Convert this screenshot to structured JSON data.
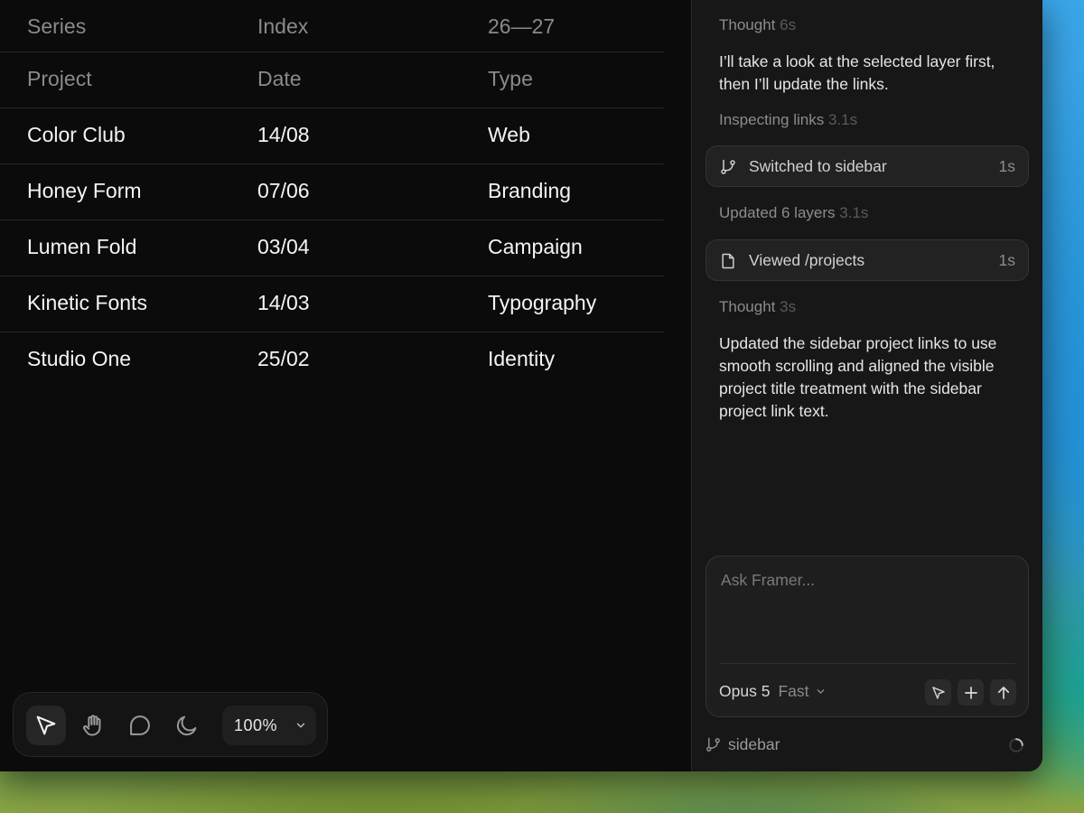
{
  "table": {
    "header_rows": [
      [
        "Series",
        "Index",
        "26—27"
      ],
      [
        "Project",
        "Date",
        "Type"
      ]
    ],
    "rows": [
      [
        "Color Club",
        "14/08",
        "Web"
      ],
      [
        "Honey Form",
        "07/06",
        "Branding"
      ],
      [
        "Lumen Fold",
        "03/04",
        "Campaign"
      ],
      [
        "Kinetic Fonts",
        "14/03",
        "Typography"
      ],
      [
        "Studio One",
        "25/02",
        "Identity"
      ]
    ]
  },
  "toolbar": {
    "tools": [
      "select-arrow-icon",
      "hand-icon",
      "comment-icon",
      "moon-icon"
    ],
    "zoom": "100%"
  },
  "panel": {
    "thought1": {
      "label": "Thought",
      "duration": "6s"
    },
    "message1": "I’ll take a look at the selected layer first, then I’ll update the links.",
    "inspecting": {
      "label": "Inspecting links",
      "duration": "3.1s"
    },
    "step1": {
      "text": "Switched to sidebar",
      "duration": "1s",
      "icon": "branch-icon"
    },
    "updated": {
      "label": "Updated 6 layers",
      "duration": "3.1s"
    },
    "step2": {
      "text": "Viewed /projects",
      "duration": "1s",
      "icon": "file-icon"
    },
    "thought2": {
      "label": "Thought",
      "duration": "3s"
    },
    "message2": "Updated the sidebar project links to use smooth scrolling and aligned the visible project title treatment with the sidebar project link text.",
    "composer": {
      "placeholder": "Ask Framer...",
      "model": "Opus 5",
      "speed": "Fast"
    },
    "branch": "sidebar"
  }
}
